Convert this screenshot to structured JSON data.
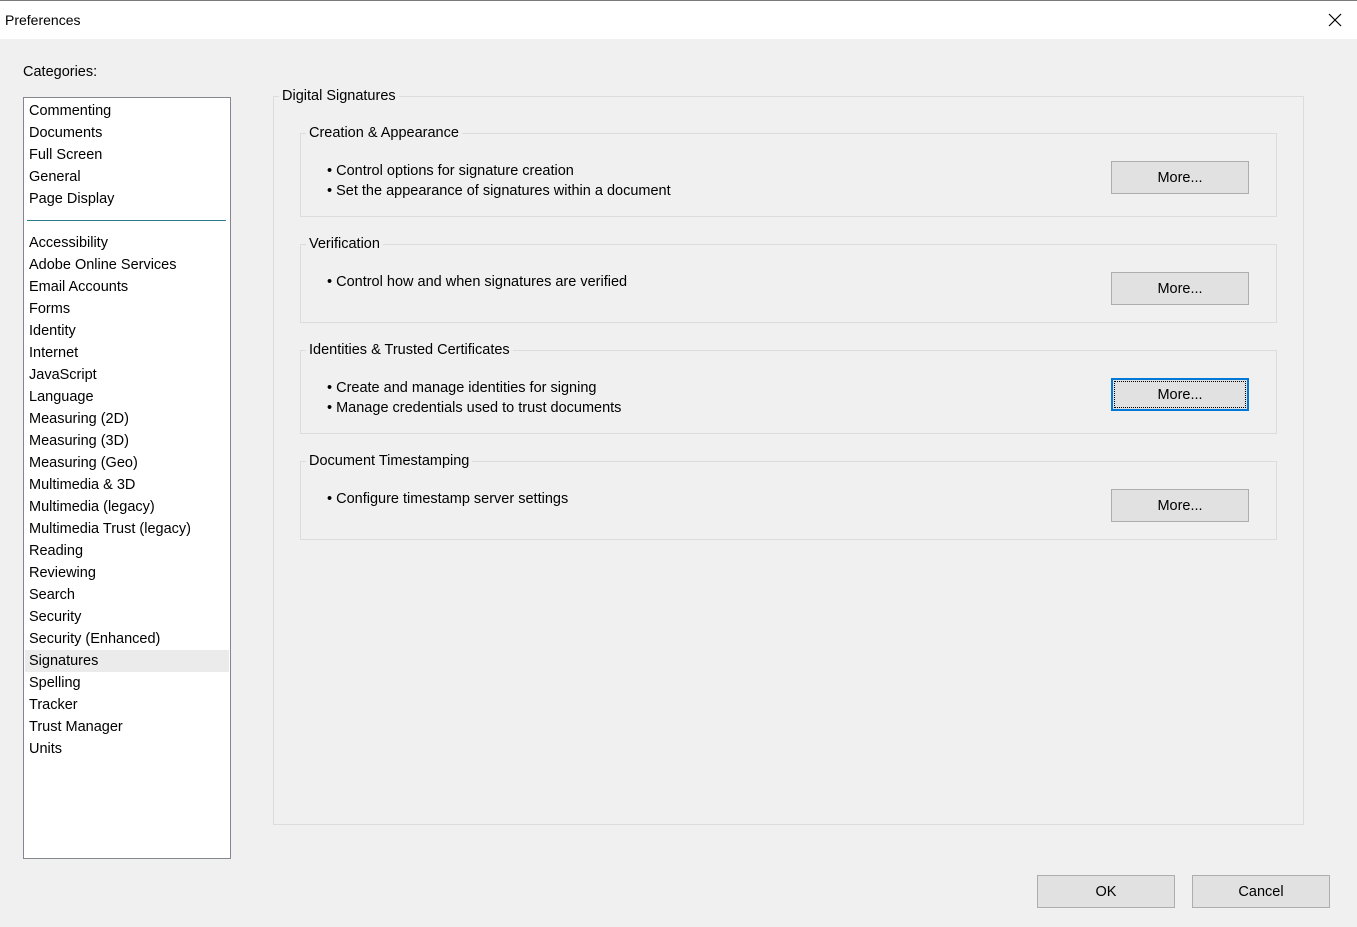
{
  "window": {
    "title": "Preferences",
    "close_icon": "close-icon"
  },
  "categories": {
    "label": "Categories:",
    "top_items": [
      {
        "label": "Commenting"
      },
      {
        "label": "Documents"
      },
      {
        "label": "Full Screen"
      },
      {
        "label": "General"
      },
      {
        "label": "Page Display"
      }
    ],
    "items": [
      {
        "label": "Accessibility"
      },
      {
        "label": "Adobe Online Services"
      },
      {
        "label": "Email Accounts"
      },
      {
        "label": "Forms"
      },
      {
        "label": "Identity"
      },
      {
        "label": "Internet"
      },
      {
        "label": "JavaScript"
      },
      {
        "label": "Language"
      },
      {
        "label": "Measuring (2D)"
      },
      {
        "label": "Measuring (3D)"
      },
      {
        "label": "Measuring (Geo)"
      },
      {
        "label": "Multimedia & 3D"
      },
      {
        "label": "Multimedia (legacy)"
      },
      {
        "label": "Multimedia Trust (legacy)"
      },
      {
        "label": "Reading"
      },
      {
        "label": "Reviewing"
      },
      {
        "label": "Search"
      },
      {
        "label": "Security"
      },
      {
        "label": "Security (Enhanced)"
      },
      {
        "label": "Signatures"
      },
      {
        "label": "Spelling"
      },
      {
        "label": "Tracker"
      },
      {
        "label": "Trust Manager"
      },
      {
        "label": "Units"
      }
    ],
    "selected": "Signatures"
  },
  "main": {
    "group_title": "Digital Signatures",
    "sections": [
      {
        "title": "Creation & Appearance",
        "bullets": [
          "• Control options for signature creation",
          "• Set the appearance of signatures within a document"
        ],
        "button_label": "More..."
      },
      {
        "title": "Verification",
        "bullets": [
          "• Control how and when signatures are verified"
        ],
        "button_label": "More..."
      },
      {
        "title": "Identities & Trusted Certificates",
        "bullets": [
          "• Create and manage identities for signing",
          "• Manage credentials used to trust documents"
        ],
        "button_label": "More..."
      },
      {
        "title": "Document Timestamping",
        "bullets": [
          "• Configure timestamp server settings"
        ],
        "button_label": "More..."
      }
    ]
  },
  "footer": {
    "ok_label": "OK",
    "cancel_label": "Cancel"
  },
  "colors": {
    "focus_border": "#0078d7",
    "separator": "#2b7b8c",
    "selected_bg": "#ebebeb"
  }
}
